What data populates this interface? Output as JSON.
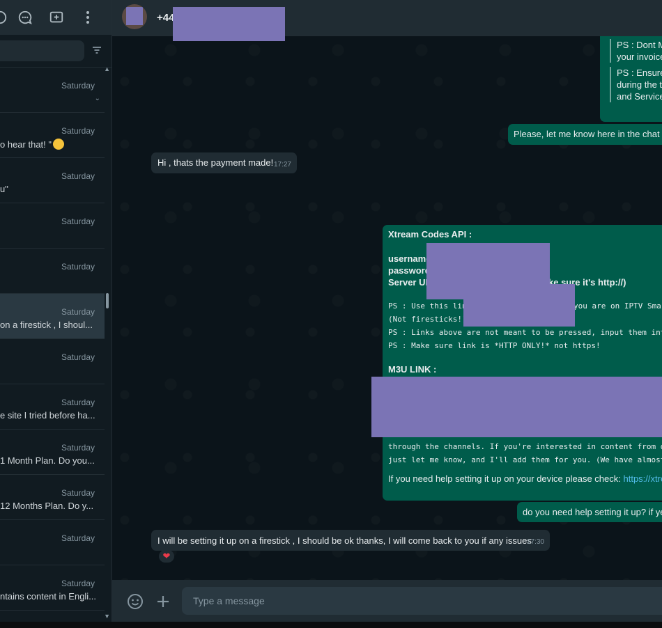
{
  "sidebar": {
    "search_placeholder": "",
    "chats": [
      {
        "time": "Saturday",
        "preview": ""
      },
      {
        "time": "Saturday",
        "preview": "o hear that! \"",
        "emoji": true
      },
      {
        "time": "Saturday",
        "preview": "u\""
      },
      {
        "time": "Saturday",
        "preview": ""
      },
      {
        "time": "Saturday",
        "preview": ""
      },
      {
        "time": "Saturday",
        "preview": "on a firestick , I shoul..."
      },
      {
        "time": "Saturday",
        "preview": ""
      },
      {
        "time": "Saturday",
        "preview": "e site I tried before ha..."
      },
      {
        "time": "Saturday",
        "preview": "1 Month Plan. Do you..."
      },
      {
        "time": "Saturday",
        "preview": "12 Months Plan. Do y..."
      },
      {
        "time": "Saturday",
        "preview": ""
      },
      {
        "time": "Saturday",
        "preview": "ntains content in Engli..."
      }
    ]
  },
  "header": {
    "contact": "+44"
  },
  "messages": {
    "ps1": "PS : Dont M",
    "ps1b": "your invoice",
    "ps2": "PS : Ensure y",
    "ps2b": "during the t",
    "ps2c": "and Services",
    "please": "Please, let me know here in the chat w",
    "hi": "Hi , thats the payment made!",
    "hi_time": "17:27",
    "xtream_title": "Xtream Codes API :",
    "username": "username",
    "password": "password",
    "server": "Server UF",
    "server_tail": "ke sure it's http://)",
    "ps_use_a": "PS : Use this lin",
    "ps_use_b": "you are on IPTV Sma",
    "not_fire": "(Not firesticks!)",
    "ps_links": "PS : Links above are not meant to be pressed, input them into",
    "ps_http": "PS : Make sure link is *HTTP ONLY!* not https!",
    "m3u": "M3U LINK :",
    "channels": "through the channels. If you're interested in content from di",
    "letknow": "just let me know, and I'll add them for you. (We have almost",
    "help_a": "If you need help setting it up on your device please check: ",
    "help_link": "https://xtre",
    "setup_q": "do you need help setting it up? if ye",
    "reply": "I will be setting it up on a firestick , I should be ok thanks, I will come back to you if any issues",
    "reply_time": "17:30",
    "reaction": "❤"
  },
  "footer": {
    "placeholder": "Type a message"
  },
  "colors": {
    "accent_out": "#005c4b",
    "incoming": "#202c33",
    "redaction": "#7b74b5"
  }
}
